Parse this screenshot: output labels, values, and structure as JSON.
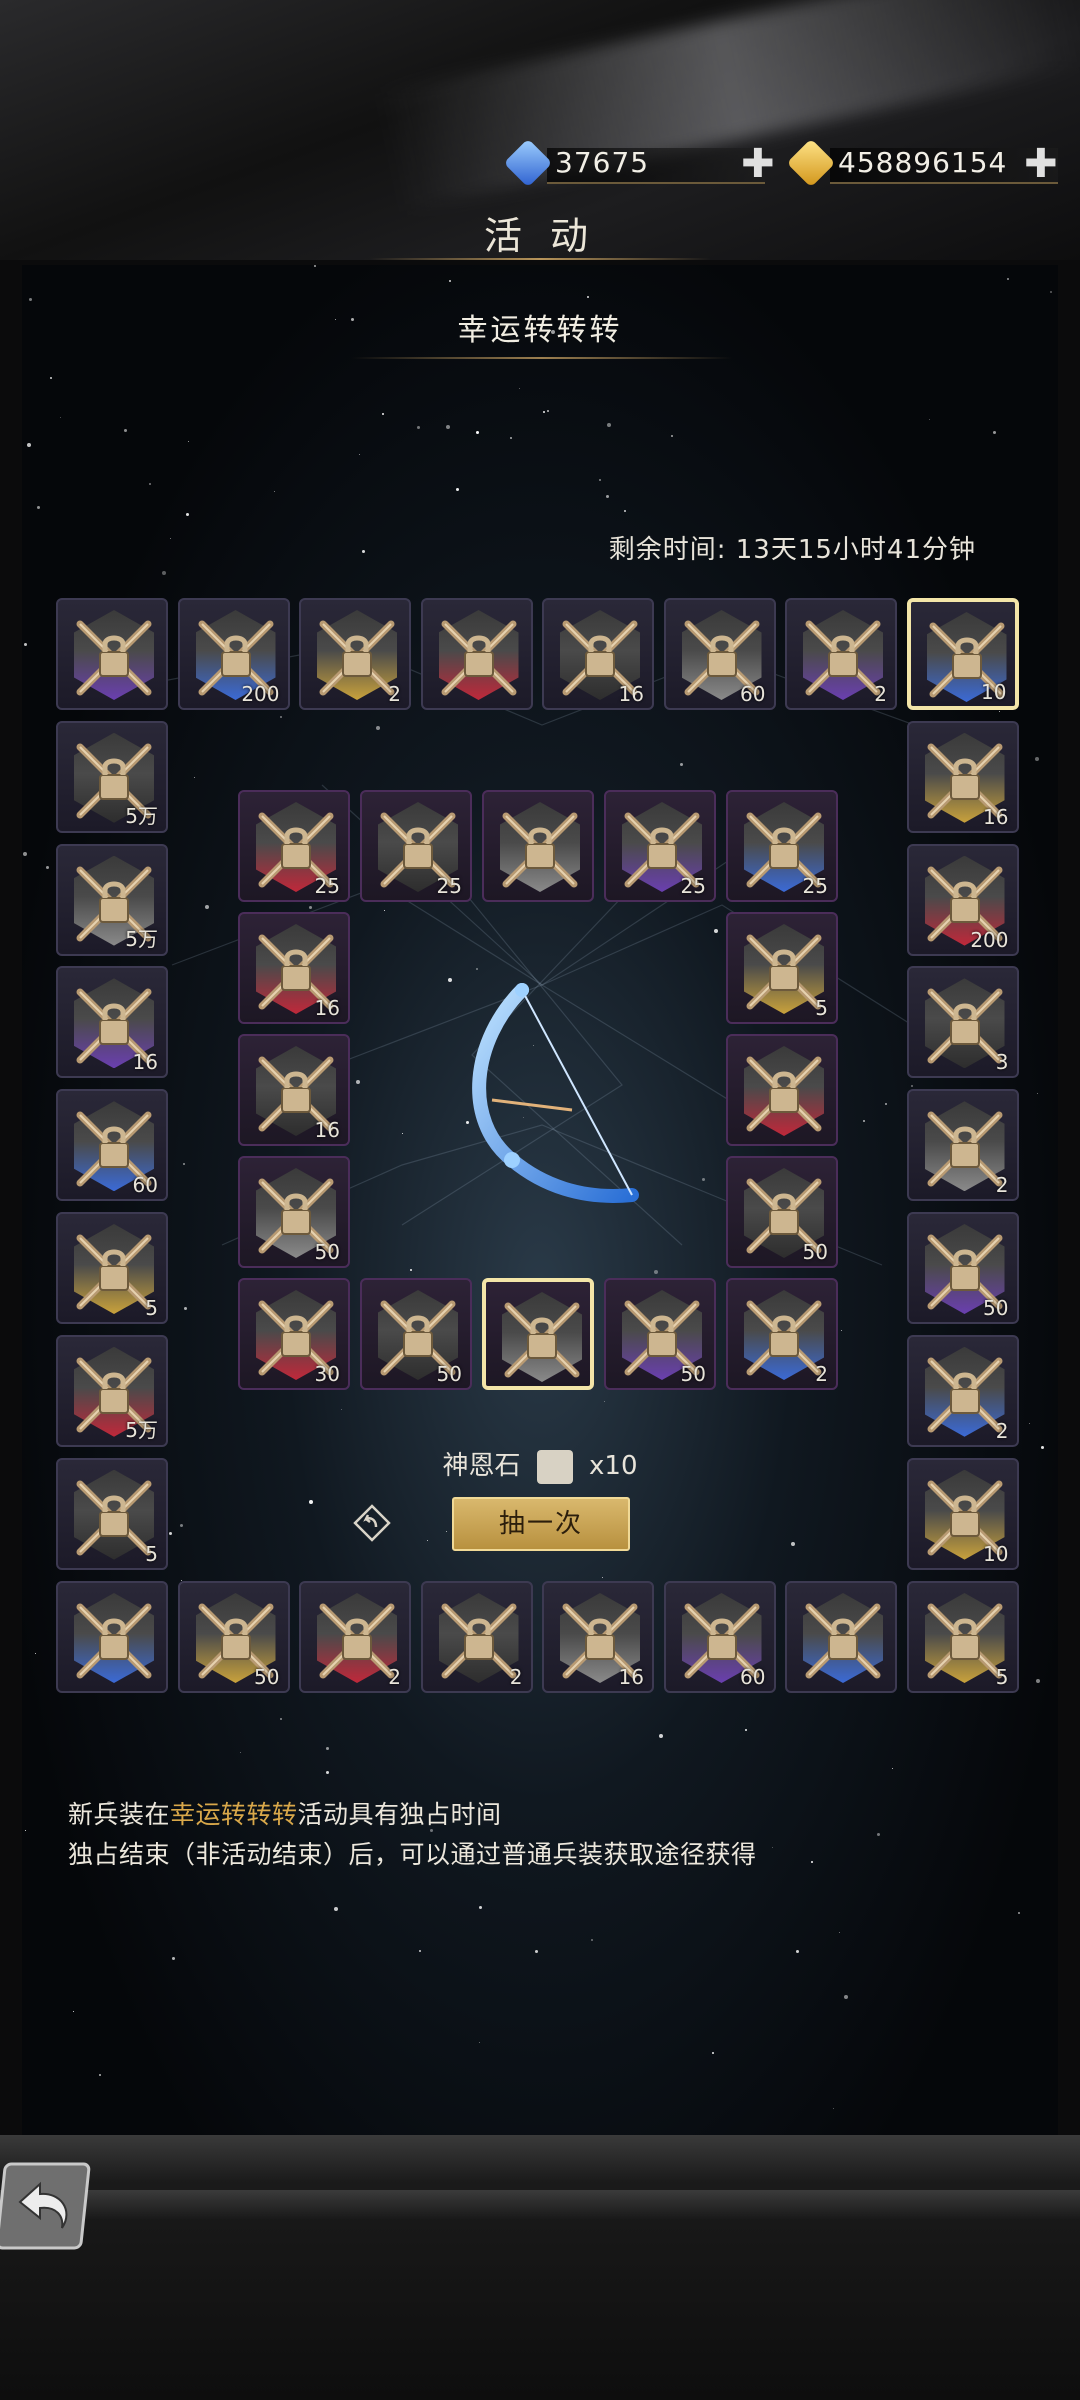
{
  "currency": {
    "diamonds": {
      "value": "37675",
      "icon": "blue-diamond-icon",
      "color": "#3f7ee8"
    },
    "gold": {
      "value": "458896154",
      "icon": "gold-gem-icon",
      "color": "#e8b52c"
    }
  },
  "header": {
    "title": "活 动"
  },
  "event": {
    "title": "幸运转转转",
    "timer": "剩余时间: 13天15小时41分钟",
    "cost_label": "神恩石",
    "cost_count": "x10",
    "draw_button": "抽一次",
    "note_line1_prefix": "新兵装在",
    "note_line1_highlight": "幸运转转转",
    "note_line1_suffix": "活动具有独占时间",
    "note_line2": "独占结束（非活动结束）后，可以通过普通兵装获取途径获得"
  },
  "outer_ring": {
    "top": [
      "",
      "200",
      "2",
      "",
      "16",
      "60",
      "2",
      "10"
    ],
    "right": [
      "16",
      "200",
      "3",
      "2",
      "50",
      "2",
      "10"
    ],
    "bottom": [
      "",
      "50",
      "2",
      "2",
      "16",
      "60",
      "",
      "5"
    ],
    "left": [
      "5万",
      "5万",
      "16",
      "60",
      "5",
      "5万",
      "5"
    ]
  },
  "inner_ring": {
    "top": [
      "25",
      "25",
      "",
      "25",
      "25"
    ],
    "right": [
      "5",
      "",
      "50"
    ],
    "bottom": [
      "30",
      "50",
      "",
      "50",
      "2"
    ],
    "left": [
      "16",
      "16",
      "50"
    ]
  },
  "colors": {
    "accent_gold": "#d9a84a",
    "selected_border": "#f3e5a8"
  }
}
